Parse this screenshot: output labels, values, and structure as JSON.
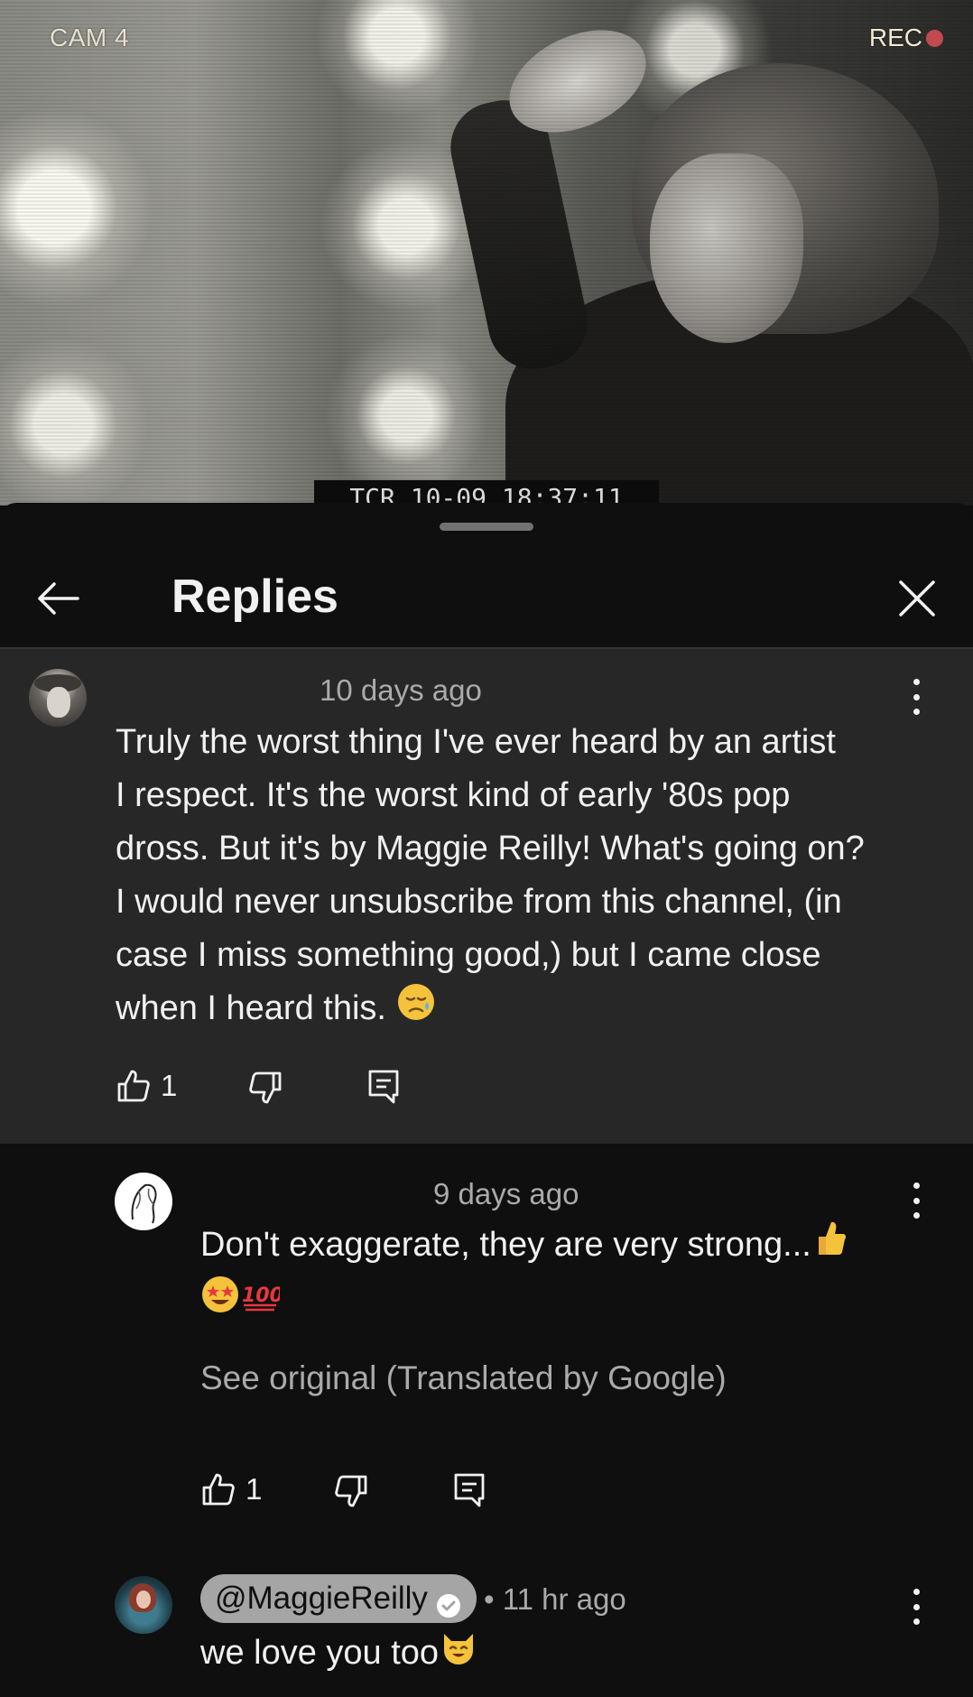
{
  "video": {
    "cam_label": "CAM 4",
    "rec_label": "REC",
    "timecode": "TCR 10-09 18:37:11"
  },
  "header": {
    "title": "Replies"
  },
  "comments": [
    {
      "time": "10 days ago",
      "text_lines": [
        "Truly the worst thing I've ever heard by an artist",
        "I respect. It's the worst kind of early '80s pop",
        "dross. But it's by Maggie Reilly! What's going on?",
        "I would never unsubscribe from this channel, (in",
        "case I miss something good,) but I came close",
        "when I heard this."
      ],
      "emoji": "sad-sweat-face",
      "likes": "1"
    },
    {
      "time": "9 days ago",
      "text_line1": "Don't exaggerate, they are very strong...",
      "emoji_line1": "thumbs-up",
      "emoji_line2": [
        "star-struck-face",
        "hundred-points"
      ],
      "translate_text": "See original (Translated by Google)",
      "likes": "1"
    },
    {
      "author": "@MaggieReilly",
      "time": "• 11 hr ago",
      "text": "we love you too",
      "emoji": "smiling-cat-face"
    }
  ],
  "colors": {
    "background": "#0f0f0f",
    "highlight": "#272727",
    "secondary_text": "#aaaaaa",
    "owner_chip": "#a5a5a5",
    "rec_dot": "#c24a4f"
  }
}
